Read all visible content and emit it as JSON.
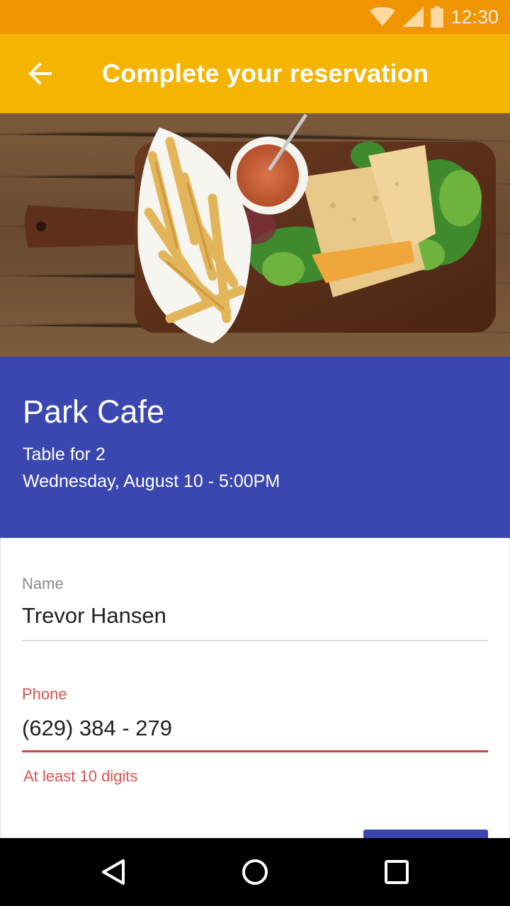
{
  "status_bar": {
    "time": "12:30",
    "icons": [
      "wifi-icon",
      "signal-icon",
      "battery-icon"
    ]
  },
  "app_bar": {
    "title": "Complete your reservation",
    "back_icon": "arrow-back-icon"
  },
  "reservation": {
    "restaurant": "Park Cafe",
    "table": "Table for 2",
    "datetime": "Wednesday, August 10 - 5:00PM"
  },
  "form": {
    "name_label": "Name",
    "name_value": "Trevor Hansen",
    "phone_label": "Phone",
    "phone_value": "(629) 384 - 279",
    "phone_error": "At least 10 digits"
  },
  "nav_bar": {
    "icons": [
      "back-triangle-icon",
      "home-circle-icon",
      "recents-square-icon"
    ]
  },
  "colors": {
    "status_bar": "#f09400",
    "app_bar": "#f4b400",
    "info_panel": "#3a47b0",
    "error": "#d9534f",
    "nav_bar": "#000000"
  }
}
